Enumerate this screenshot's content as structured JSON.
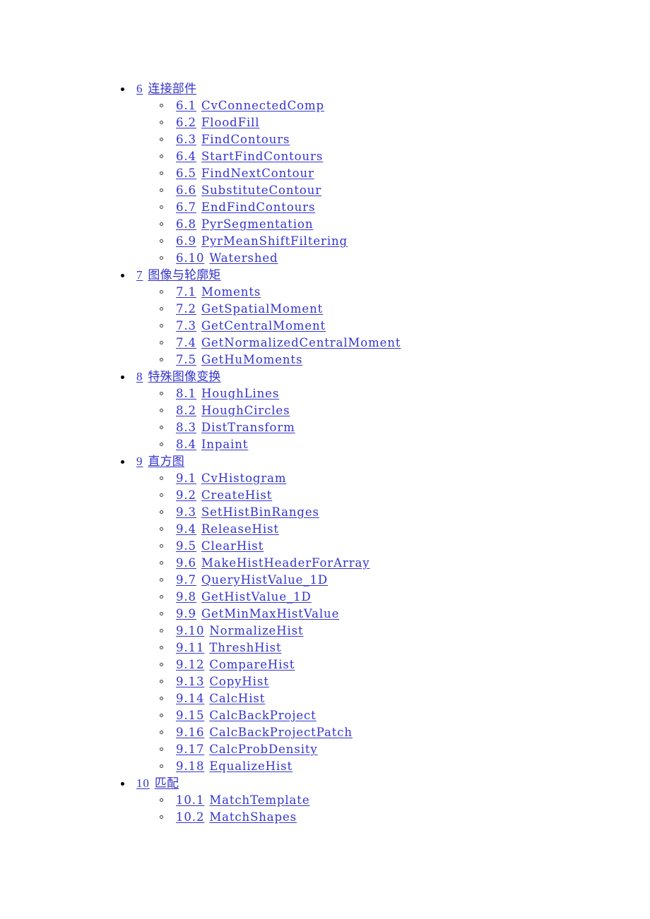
{
  "page": {
    "background_color": "#ffffff",
    "link_color": "#3333cc",
    "bullet_level1_color": "#000000",
    "bullet_level2_color": "#3b3b3b",
    "bullet_level1_glyph": "filled-disc",
    "bullet_level2_glyph": "hollow-circle"
  },
  "toc": {
    "sections": [
      {
        "number": "6",
        "title": "连接部件",
        "script": "cjk",
        "items": [
          {
            "number": "6.1",
            "title": "CvConnectedComp"
          },
          {
            "number": "6.2",
            "title": "FloodFill"
          },
          {
            "number": "6.3",
            "title": "FindContours"
          },
          {
            "number": "6.4",
            "title": "StartFindContours"
          },
          {
            "number": "6.5",
            "title": "FindNextContour"
          },
          {
            "number": "6.6",
            "title": "SubstituteContour"
          },
          {
            "number": "6.7",
            "title": "EndFindContours"
          },
          {
            "number": "6.8",
            "title": "PyrSegmentation"
          },
          {
            "number": "6.9",
            "title": "PyrMeanShiftFiltering"
          },
          {
            "number": "6.10",
            "title": "Watershed"
          }
        ]
      },
      {
        "number": "7",
        "title": "图像与轮廓矩",
        "script": "cjk",
        "items": [
          {
            "number": "7.1",
            "title": "Moments"
          },
          {
            "number": "7.2",
            "title": "GetSpatialMoment"
          },
          {
            "number": "7.3",
            "title": "GetCentralMoment"
          },
          {
            "number": "7.4",
            "title": "GetNormalizedCentralMoment"
          },
          {
            "number": "7.5",
            "title": "GetHuMoments"
          }
        ]
      },
      {
        "number": "8",
        "title": "特殊图像变换",
        "script": "cjk",
        "items": [
          {
            "number": "8.1",
            "title": "HoughLines"
          },
          {
            "number": "8.2",
            "title": "HoughCircles"
          },
          {
            "number": "8.3",
            "title": "DistTransform"
          },
          {
            "number": "8.4",
            "title": "Inpaint"
          }
        ]
      },
      {
        "number": "9",
        "title": "直方图",
        "script": "cjk",
        "items": [
          {
            "number": "9.1",
            "title": "CvHistogram"
          },
          {
            "number": "9.2",
            "title": "CreateHist"
          },
          {
            "number": "9.3",
            "title": "SetHistBinRanges"
          },
          {
            "number": "9.4",
            "title": "ReleaseHist"
          },
          {
            "number": "9.5",
            "title": "ClearHist"
          },
          {
            "number": "9.6",
            "title": "MakeHistHeaderForArray"
          },
          {
            "number": "9.7",
            "title": "QueryHistValue_1D"
          },
          {
            "number": "9.8",
            "title": "GetHistValue_1D"
          },
          {
            "number": "9.9",
            "title": "GetMinMaxHistValue"
          },
          {
            "number": "9.10",
            "title": "NormalizeHist"
          },
          {
            "number": "9.11",
            "title": "ThreshHist"
          },
          {
            "number": "9.12",
            "title": "CompareHist"
          },
          {
            "number": "9.13",
            "title": "CopyHist"
          },
          {
            "number": "9.14",
            "title": "CalcHist"
          },
          {
            "number": "9.15",
            "title": "CalcBackProject"
          },
          {
            "number": "9.16",
            "title": "CalcBackProjectPatch"
          },
          {
            "number": "9.17",
            "title": "CalcProbDensity"
          },
          {
            "number": "9.18",
            "title": "EqualizeHist"
          }
        ]
      },
      {
        "number": "10",
        "title": "匹配",
        "script": "cjk",
        "items": [
          {
            "number": "10.1",
            "title": "MatchTemplate"
          },
          {
            "number": "10.2",
            "title": "MatchShapes"
          }
        ]
      }
    ]
  }
}
